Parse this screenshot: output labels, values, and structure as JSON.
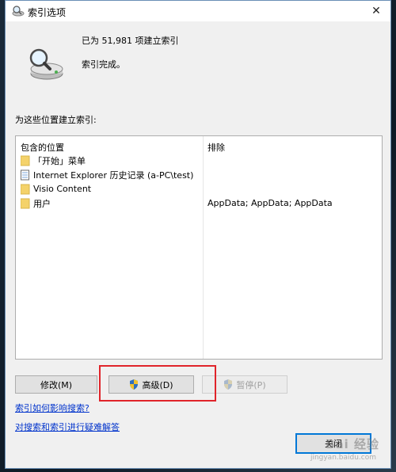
{
  "window": {
    "title": "索引选项",
    "close_glyph": "✕"
  },
  "status": {
    "count_text": "已为 51,981 项建立索引",
    "state_text": "索引完成。"
  },
  "locations": {
    "section_label": "为这些位置建立索引:",
    "columns": [
      "包含的位置",
      "排除"
    ],
    "rows": [
      {
        "name": "「开始」菜单",
        "exclude": "",
        "icon": "folder-icon"
      },
      {
        "name": "Internet Explorer 历史记录 (a-PC\\test)",
        "exclude": "",
        "icon": "ie-history-icon"
      },
      {
        "name": "Visio Content",
        "exclude": "",
        "icon": "folder-icon"
      },
      {
        "name": "用户",
        "exclude": "AppData; AppData; AppData",
        "icon": "folder-icon"
      }
    ]
  },
  "buttons": {
    "modify": "修改(M)",
    "advanced": "高级(D)",
    "pause": "暂停(P)",
    "close": "关闭"
  },
  "links": {
    "affect_search": "索引如何影响搜索?",
    "troubleshoot": "对搜索和索引进行疑难解答"
  },
  "watermark": {
    "text": "Bai 经验",
    "sub": "jingyan.baidu.com"
  },
  "colors": {
    "highlight": "#e0242a",
    "link": "#0033cc",
    "focus": "#0078d7"
  }
}
